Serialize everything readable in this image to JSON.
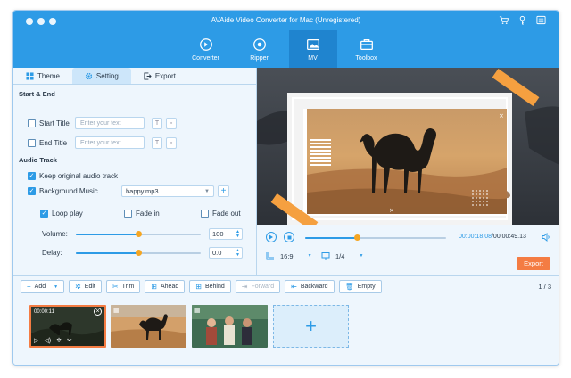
{
  "window": {
    "title": "AVAide Video Converter for Mac (Unregistered)"
  },
  "nav": [
    {
      "label": "Converter",
      "icon": "converter-icon"
    },
    {
      "label": "Ripper",
      "icon": "ripper-icon"
    },
    {
      "label": "MV",
      "icon": "mv-icon",
      "active": true
    },
    {
      "label": "Toolbox",
      "icon": "toolbox-icon"
    }
  ],
  "tabs": [
    {
      "label": "Theme"
    },
    {
      "label": "Setting",
      "active": true
    },
    {
      "label": "Export"
    }
  ],
  "start_end": {
    "title": "Start & End",
    "start_title_label": "Start Title",
    "start_title_placeholder": "Enter your text",
    "end_title_label": "End Title",
    "end_title_placeholder": "Enter your text"
  },
  "audio": {
    "title": "Audio Track",
    "keep_original_label": "Keep original audio track",
    "keep_original_checked": true,
    "background_music_label": "Background Music",
    "background_music_checked": true,
    "music_file": "happy.mp3",
    "loop_play_label": "Loop play",
    "loop_play_checked": true,
    "fade_in_label": "Fade in",
    "fade_out_label": "Fade out",
    "volume_label": "Volume:",
    "volume_value": "100",
    "volume_fraction": 0.5,
    "delay_label": "Delay:",
    "delay_value": "0.0",
    "delay_fraction": 0.5
  },
  "player": {
    "current_time": "00:00:18.08",
    "total_time": "/00:00:49.13",
    "progress_fraction": 0.37,
    "aspect_ratio": "16:9",
    "page": "1/4",
    "export_label": "Export"
  },
  "toolbar": {
    "add_label": "Add",
    "edit_label": "Edit",
    "trim_label": "Trim",
    "ahead_label": "Ahead",
    "behind_label": "Behind",
    "forward_label": "Forward",
    "backward_label": "Backward",
    "empty_label": "Empty",
    "page_count": "1 / 3"
  },
  "timeline": {
    "first_clip_time": "00:00:11"
  },
  "colors": {
    "accent": "#2d9be6",
    "export": "#f47c43",
    "knob": "#f5a623"
  }
}
